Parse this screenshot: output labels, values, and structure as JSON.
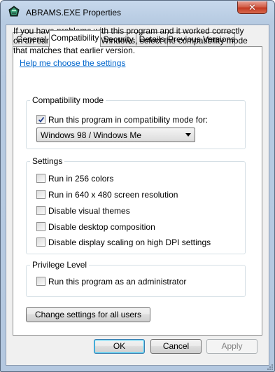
{
  "window": {
    "title": "ABRAMS.EXE Properties",
    "close_glyph": "✕",
    "accent": "#3c7fb1",
    "close_color": "#c43a22"
  },
  "tabs": [
    {
      "label": "General",
      "active": false
    },
    {
      "label": "Compatibility",
      "active": true
    },
    {
      "label": "Security",
      "active": false
    },
    {
      "label": "Details",
      "active": false
    },
    {
      "label": "Previous Versions",
      "active": false
    }
  ],
  "compat": {
    "intro": "If you have problems with this program and it worked correctly on an earlier version of Windows, select the compatibility mode that matches that earlier version.",
    "help_link": "Help me choose the settings",
    "mode_group": {
      "legend": "Compatibility mode",
      "checkbox_label": "Run this program in compatibility mode for:",
      "checked": true,
      "selected_os": "Windows 98 / Windows Me"
    },
    "settings_group": {
      "legend": "Settings",
      "items": [
        {
          "label": "Run in 256 colors",
          "checked": false
        },
        {
          "label": "Run in 640 x 480 screen resolution",
          "checked": false
        },
        {
          "label": "Disable visual themes",
          "checked": false
        },
        {
          "label": "Disable desktop composition",
          "checked": false
        },
        {
          "label": "Disable display scaling on high DPI settings",
          "checked": false
        }
      ]
    },
    "privilege_group": {
      "legend": "Privilege Level",
      "checkbox_label": "Run this program as an administrator",
      "checked": false
    },
    "all_users_button": "Change settings for all users"
  },
  "footer": {
    "ok": "OK",
    "cancel": "Cancel",
    "apply": "Apply"
  },
  "icons": {
    "app": "blue-green-diamond-icon",
    "close": "close-icon",
    "dropdown": "chevron-down-icon",
    "check": "checkmark-icon",
    "grip": "resize-grip-icon"
  }
}
